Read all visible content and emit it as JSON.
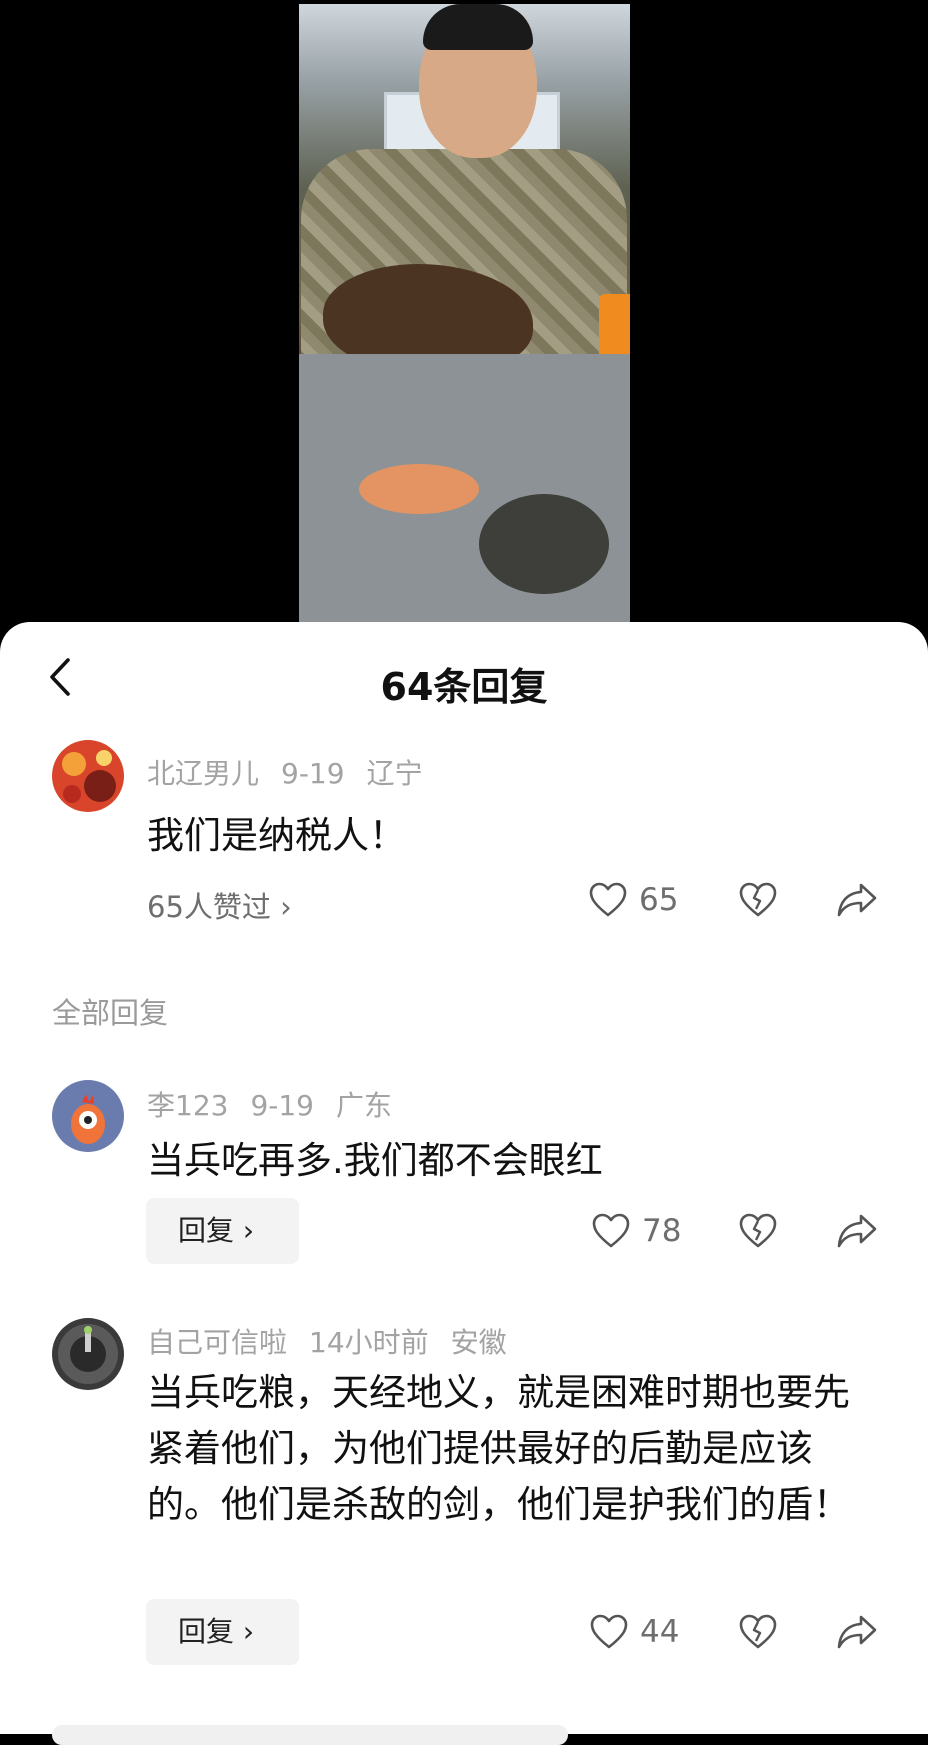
{
  "header": {
    "title": "64条回复"
  },
  "main_comment": {
    "author": "北辽男儿",
    "date": "9-19",
    "location": "辽宁",
    "text": "我们是纳税人！",
    "liked_by": "65人赞过 ›",
    "likes": "65"
  },
  "replies_section": {
    "label": "全部回复"
  },
  "replies": [
    {
      "author": "李123",
      "date": "9-19",
      "location": "广东",
      "text": "当兵吃再多.我们都不会眼红",
      "reply_label": "回复 ›",
      "likes": "78"
    },
    {
      "author": "自己可信啦",
      "date": "14小时前",
      "location": "安徽",
      "text": "当兵吃粮，天经地义，就是困难时期也要先紧着他们，为他们提供最好的后勤是应该的。他们是杀敌的剑，他们是护我们的盾！",
      "reply_label": "回复 ›",
      "likes": "44"
    }
  ],
  "icons": {
    "back": "chevron-left-icon",
    "like": "heart-outline-icon",
    "dislike": "broken-heart-icon",
    "share": "share-arrow-icon"
  },
  "colors": {
    "sheet_background": "#ffffff",
    "video_background": "#000000",
    "meta_text": "#a3a3a3",
    "primary_text": "#111111"
  }
}
